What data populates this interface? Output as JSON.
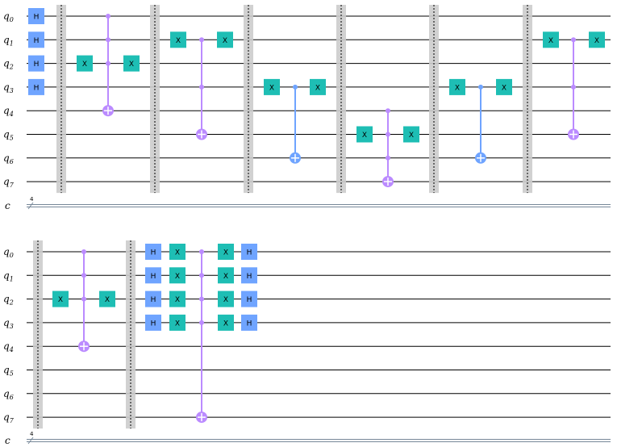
{
  "colors": {
    "h": "#6fa4ff",
    "x": "#1ebeb4",
    "mcx": "#bb8bff",
    "cx": "#6fa4ff",
    "barrier": "#cccccc",
    "wire": "#000000",
    "creg": "#778899"
  },
  "rows": [
    {
      "qubits": [
        "q0",
        "q1",
        "q2",
        "q3",
        "q4",
        "q5",
        "q6",
        "q7"
      ],
      "creg": {
        "label": "c",
        "size": "4"
      },
      "elements": [
        {
          "kind": "gate",
          "name": "H",
          "col": 0,
          "qubits": [
            0,
            1,
            2,
            3
          ]
        },
        {
          "kind": "barrier",
          "col": 1
        },
        {
          "kind": "gate",
          "name": "X",
          "col": 2,
          "qubits": [
            2
          ]
        },
        {
          "kind": "mcx",
          "col": 3,
          "controls": [
            0,
            1,
            2
          ],
          "target": 4
        },
        {
          "kind": "gate",
          "name": "X",
          "col": 4,
          "qubits": [
            2
          ]
        },
        {
          "kind": "barrier",
          "col": 5
        },
        {
          "kind": "gate",
          "name": "X",
          "col": 6,
          "qubits": [
            1
          ]
        },
        {
          "kind": "mcx",
          "col": 7,
          "controls": [
            1,
            3
          ],
          "target": 5
        },
        {
          "kind": "gate",
          "name": "X",
          "col": 8,
          "qubits": [
            1
          ]
        },
        {
          "kind": "barrier",
          "col": 9
        },
        {
          "kind": "gate",
          "name": "X",
          "col": 10,
          "qubits": [
            3
          ]
        },
        {
          "kind": "cx",
          "col": 11,
          "controls": [
            3
          ],
          "target": 6
        },
        {
          "kind": "gate",
          "name": "X",
          "col": 12,
          "qubits": [
            3
          ]
        },
        {
          "kind": "barrier",
          "col": 13
        },
        {
          "kind": "gate",
          "name": "X",
          "col": 14,
          "qubits": [
            5
          ]
        },
        {
          "kind": "mcx",
          "col": 15,
          "controls": [
            4,
            5,
            6
          ],
          "target": 7
        },
        {
          "kind": "gate",
          "name": "X",
          "col": 16,
          "qubits": [
            5
          ]
        },
        {
          "kind": "barrier",
          "col": 17
        },
        {
          "kind": "gate",
          "name": "X",
          "col": 18,
          "qubits": [
            3
          ]
        },
        {
          "kind": "cx",
          "col": 19,
          "controls": [
            3
          ],
          "target": 6
        },
        {
          "kind": "gate",
          "name": "X",
          "col": 20,
          "qubits": [
            3
          ]
        },
        {
          "kind": "barrier",
          "col": 21
        },
        {
          "kind": "gate",
          "name": "X",
          "col": 22,
          "qubits": [
            1
          ]
        },
        {
          "kind": "mcx",
          "col": 23,
          "controls": [
            1,
            3
          ],
          "target": 5
        },
        {
          "kind": "gate",
          "name": "X",
          "col": 24,
          "qubits": [
            1
          ]
        }
      ]
    },
    {
      "qubits": [
        "q0",
        "q1",
        "q2",
        "q3",
        "q4",
        "q5",
        "q6",
        "q7"
      ],
      "creg": {
        "label": "c",
        "size": "4"
      },
      "elements": [
        {
          "kind": "barrier",
          "col": 0
        },
        {
          "kind": "gate",
          "name": "X",
          "col": 1,
          "qubits": [
            2
          ]
        },
        {
          "kind": "mcx",
          "col": 2,
          "controls": [
            0,
            1,
            2
          ],
          "target": 4
        },
        {
          "kind": "gate",
          "name": "X",
          "col": 3,
          "qubits": [
            2
          ]
        },
        {
          "kind": "barrier",
          "col": 4
        },
        {
          "kind": "gate",
          "name": "H",
          "col": 5,
          "qubits": [
            0,
            1,
            2,
            3
          ]
        },
        {
          "kind": "gate",
          "name": "X",
          "col": 6,
          "qubits": [
            0,
            1,
            2,
            3
          ]
        },
        {
          "kind": "mcx",
          "col": 7,
          "controls": [
            0,
            1,
            2,
            3
          ],
          "target": 7
        },
        {
          "kind": "gate",
          "name": "X",
          "col": 8,
          "qubits": [
            0,
            1,
            2,
            3
          ]
        },
        {
          "kind": "gate",
          "name": "H",
          "col": 9,
          "qubits": [
            0,
            1,
            2,
            3
          ]
        }
      ]
    }
  ]
}
